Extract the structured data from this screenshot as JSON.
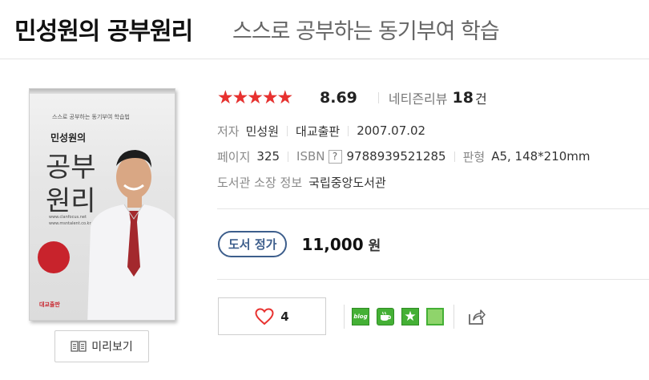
{
  "header": {
    "title": "민성원의 공부원리",
    "subtitle": "스스로 공부하는 동기부여 학습"
  },
  "cover": {
    "subtitle": "스스로 공부하는 동기부여 학습법",
    "author": "민성원의",
    "big_line1": "공부",
    "big_line2": "원리",
    "url_lines": "www.clanfocus.net\nwww.msntalent.co.kr",
    "publisher_logo": "대교출판"
  },
  "preview_button": {
    "label": "미리보기",
    "icon": "book-preview-icon"
  },
  "rating": {
    "stars_fraction": 0.869,
    "score": "8.69",
    "review_label": "네티즌리뷰",
    "review_count": "18",
    "review_unit": "건",
    "star_color": "#e8312f"
  },
  "meta": {
    "author_label": "저자",
    "author": "민성원",
    "publisher": "대교출판",
    "date": "2007.07.02",
    "pages_label": "페이지",
    "pages": "325",
    "isbn_label": "ISBN",
    "isbn_help": "?",
    "isbn": "9788939521285",
    "format_label": "판형",
    "format": "A5, 148*210mm",
    "library_label": "도서관 소장 정보",
    "library": "국립중앙도서관"
  },
  "price": {
    "badge": "도서 정가",
    "amount": "11,000",
    "unit": "원",
    "badge_color": "#3d5e8c"
  },
  "like": {
    "icon": "heart-outline-icon",
    "count": "4"
  },
  "share": {
    "blog_label": "blog",
    "icons": [
      "blog-icon",
      "cafe-icon",
      "bookmark-star-icon",
      "memo-icon",
      "share-icon"
    ],
    "brand_color": "#44b035"
  }
}
